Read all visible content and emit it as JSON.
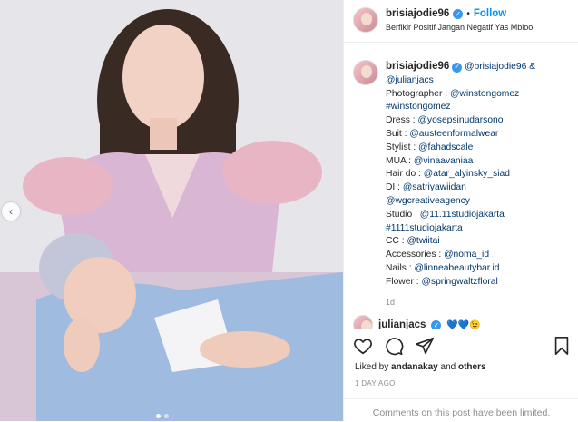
{
  "post": {
    "username": "brisiajodie96",
    "follow_label": "Follow",
    "bio": "Berfikir Positif Jangan Negatif Yas Mbloo"
  },
  "caption": {
    "username": "brisiajodie96",
    "lines": [
      {
        "prefix": "",
        "links": "@brisiajodie96 &",
        "trail": ""
      },
      {
        "prefix": "",
        "links": "@julianjacs",
        "trail": ""
      },
      {
        "prefix": "Photographer : ",
        "links": "@winstongomez",
        "trail": ""
      },
      {
        "prefix": "",
        "links": "#winstongomez",
        "trail": ""
      },
      {
        "prefix": "Dress : ",
        "links": "@yosepsinudarsono",
        "trail": ""
      },
      {
        "prefix": "Suit : ",
        "links": "@austeenformalwear",
        "trail": ""
      },
      {
        "prefix": "Stylist : ",
        "links": "@fahadscale",
        "trail": ""
      },
      {
        "prefix": "MUA : ",
        "links": "@vinaavaniaa",
        "trail": ""
      },
      {
        "prefix": "Hair do : ",
        "links": "@atar_alyinsky_siad",
        "trail": ""
      },
      {
        "prefix": "DI : ",
        "links": "@satriyawiidan",
        "trail": ""
      },
      {
        "prefix": "",
        "links": "@wgcreativeagency",
        "trail": ""
      },
      {
        "prefix": "Studio : ",
        "links": "@11.11studiojakarta",
        "trail": ""
      },
      {
        "prefix": "",
        "links": "#1111studiojakarta",
        "trail": ""
      },
      {
        "prefix": "CC : ",
        "links": "@twiitai",
        "trail": ""
      },
      {
        "prefix": "Accessories : ",
        "links": "@noma_id",
        "trail": ""
      },
      {
        "prefix": "Nails : ",
        "links": "@linneabeautybar.id",
        "trail": ""
      },
      {
        "prefix": "Flower : ",
        "links": "@springwaltzfloral",
        "trail": ""
      }
    ],
    "time": "1d"
  },
  "reply": {
    "username": "julianjacs",
    "text": "💙💙😉"
  },
  "actions": {
    "icons": [
      "heart-icon",
      "comment-icon",
      "share-icon",
      "bookmark-icon"
    ],
    "liked_by_prefix": "Liked by ",
    "liked_by_user": "andanakay",
    "liked_by_suffix": " and ",
    "liked_by_others": "others",
    "date": "1 DAY AGO",
    "limited_text": "Comments on this post have been limited."
  },
  "colors": {
    "link": "#00376b",
    "follow": "#0095f6",
    "muted": "#8e8e8e"
  }
}
